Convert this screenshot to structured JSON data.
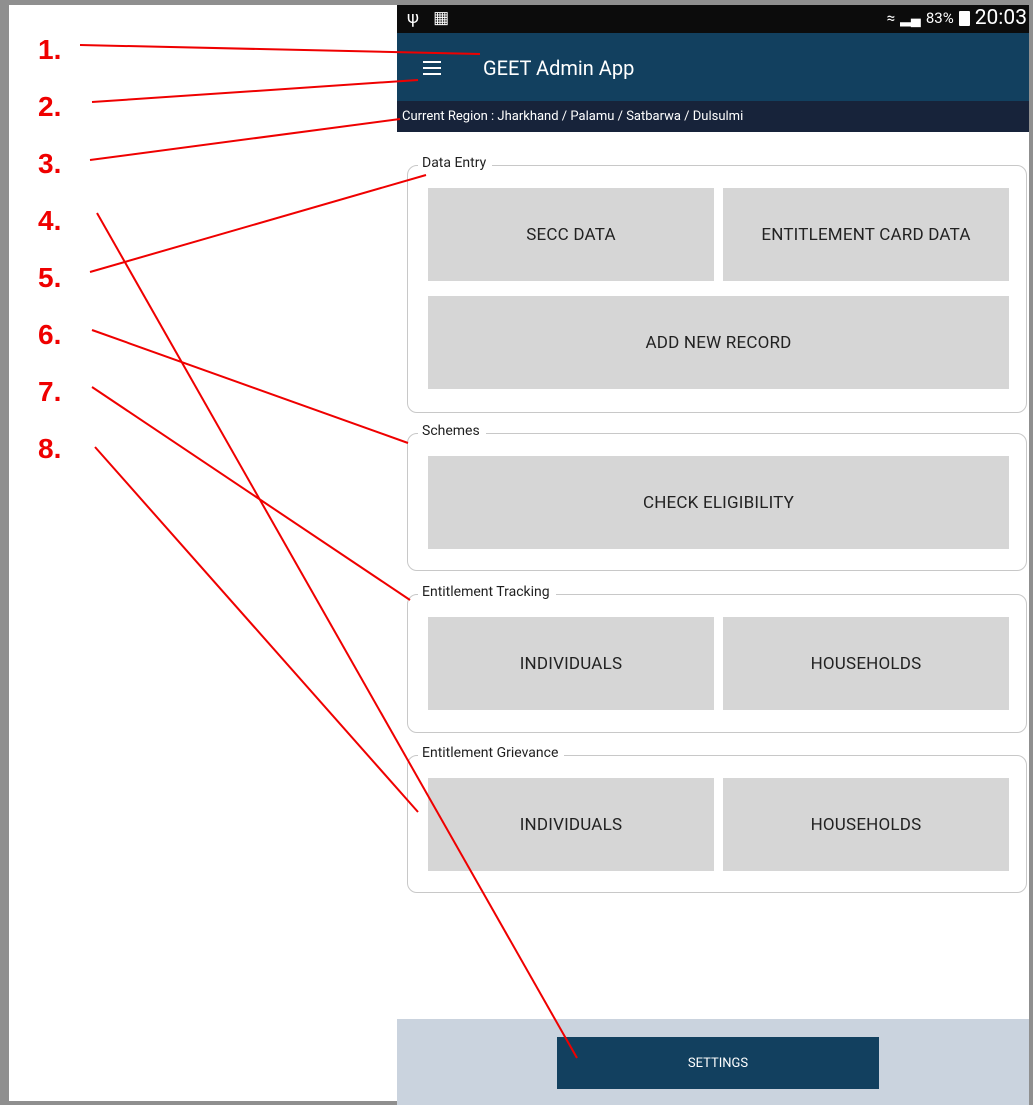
{
  "annotations": [
    "1.",
    "2.",
    "3.",
    "4.",
    "5.",
    "6.",
    "7.",
    "8."
  ],
  "status_bar": {
    "left_icons": [
      "usb-icon",
      "sim-icon"
    ],
    "signal_text": "83%",
    "time": "20:03"
  },
  "app_bar": {
    "title": "GEET Admin App",
    "menu_icon": "hamburger-menu-icon"
  },
  "region_bar": {
    "text": "Current Region : Jharkhand / Palamu / Satbarwa / Dulsulmi"
  },
  "sections": {
    "data_entry": {
      "legend": "Data Entry",
      "secc_data": "SECC DATA",
      "entitlement_card_data": "ENTITLEMENT CARD DATA",
      "add_new_record": "ADD NEW RECORD"
    },
    "schemes": {
      "legend": "Schemes",
      "check_eligibility": "CHECK ELIGIBILITY"
    },
    "entitlement_tracking": {
      "legend": "Entitlement Tracking",
      "individuals": "INDIVIDUALS",
      "households": "HOUSEHOLDS"
    },
    "entitlement_grievance": {
      "legend": "Entitlement Grievance",
      "individuals": "INDIVIDUALS",
      "households": "HOUSEHOLDS"
    }
  },
  "bottom": {
    "settings": "SETTINGS"
  },
  "colors": {
    "app_bar": "#12405f",
    "region_bar": "#17233a",
    "button_bg": "#d6d6d6",
    "annotation": "#ef0000",
    "bottom_area": "#cad3de"
  }
}
